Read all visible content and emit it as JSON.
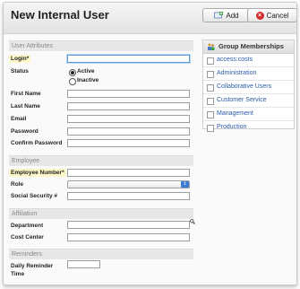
{
  "header": {
    "title": "New Internal User",
    "add_label": "Add",
    "cancel_label": "Cancel"
  },
  "sections": {
    "user_attributes": "User Attributes",
    "employee": "Employee",
    "affiliation": "Affiliation",
    "reminders": "Reminders"
  },
  "fields": {
    "login": "Login*",
    "status": "Status",
    "status_active": "Active",
    "status_inactive": "Inactive",
    "first_name": "First Name",
    "last_name": "Last Name",
    "email": "Email",
    "password": "Password",
    "confirm_password": "Confirm Password",
    "employee_number": "Employee Number*",
    "role": "Role",
    "ssn": "Social Security #",
    "department": "Department",
    "cost_center": "Cost Center",
    "daily_reminder_line1": "Daily Reminder",
    "daily_reminder_line2": "Time"
  },
  "group_memberships": {
    "title": "Group Memberships",
    "items": [
      "access:costs",
      "Administration",
      "Collaborative Users",
      "Customer Service",
      "Management",
      "Production"
    ]
  }
}
